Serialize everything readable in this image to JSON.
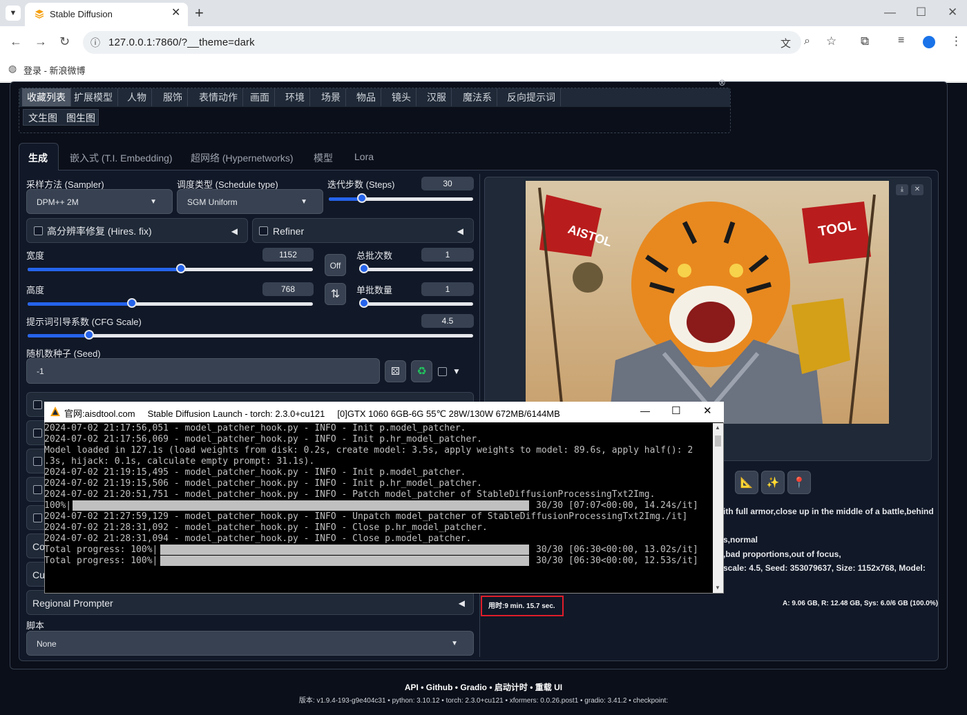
{
  "browser": {
    "tab_title": "Stable Diffusion",
    "url": "127.0.0.1:7860/?__theme=dark",
    "bookmark": "登录 - 新浪微博"
  },
  "top_tabs": [
    "收藏列表",
    "扩展模型",
    "人物",
    "服饰",
    "表情动作",
    "画面",
    "环境",
    "场景",
    "物品",
    "镜头",
    "汉服",
    "魔法系",
    "反向提示词"
  ],
  "sub_tabs": [
    "文生图",
    "图生图"
  ],
  "main_tabs": [
    "生成",
    "嵌入式 (T.I. Embedding)",
    "超网络 (Hypernetworks)",
    "模型",
    "Lora"
  ],
  "sampler": {
    "label": "采样方法 (Sampler)",
    "value": "DPM++ 2M"
  },
  "schedule": {
    "label": "调度类型 (Schedule type)",
    "value": "SGM Uniform"
  },
  "steps": {
    "label": "迭代步数 (Steps)",
    "value": "30",
    "fraction": 0.21
  },
  "hires": {
    "label": "高分辨率修复 (Hires. fix)"
  },
  "refiner": {
    "label": "Refiner"
  },
  "width": {
    "label": "宽度",
    "value": "1152",
    "fraction": 0.54
  },
  "height": {
    "label": "高度",
    "value": "768",
    "fraction": 0.36
  },
  "batch_count": {
    "label": "总批次数",
    "value": "1",
    "fraction": 0.0
  },
  "batch_size": {
    "label": "单批数量",
    "value": "1",
    "fraction": 0.0
  },
  "off_button": "Off",
  "swap_icon": "⇅",
  "cfg": {
    "label": "提示词引导系数 (CFG Scale)",
    "value": "4.5",
    "fraction": 0.13
  },
  "seed": {
    "label": "随机数种子 (Seed)",
    "value": "-1"
  },
  "partial_accordions": [
    "Co",
    "Cut"
  ],
  "regional": "Regional Prompter",
  "script": {
    "label": "脚本",
    "value": "None"
  },
  "console": {
    "title": "官网:aisdtool.com     Stable Diffusion Launch - torch: 2.3.0+cu121     [0]GTX 1060 6GB-6G 55℃ 28W/130W 672MB/6144MB",
    "lines": [
      "2024-07-02 21:17:56,051 - model_patcher_hook.py - INFO - Init p.model_patcher.",
      "2024-07-02 21:17:56,069 - model_patcher_hook.py - INFO - Init p.hr_model_patcher.",
      "Model loaded in 127.1s (load weights from disk: 0.2s, create model: 3.5s, apply weights to model: 89.6s, apply half(): 2",
      ".3s, hijack: 0.1s, calculate empty prompt: 31.1s).",
      "2024-07-02 21:19:15,495 - model_patcher_hook.py - INFO - Init p.model_patcher.",
      "2024-07-02 21:19:15,506 - model_patcher_hook.py - INFO - Init p.hr_model_patcher.",
      "2024-07-02 21:20:51,751 - model_patcher_hook.py - INFO - Patch model_patcher of StableDiffusionProcessingTxt2Img.",
      "100%|",
      "2024-07-02 21:27:59,129 - model_patcher_hook.py - INFO - Unpatch model_patcher of StableDiffusionProcessingTxt2Img./it]",
      "2024-07-02 21:28:31,092 - model_patcher_hook.py - INFO - Close p.hr_model_patcher.",
      "2024-07-02 21:28:31,094 - model_patcher_hook.py - INFO - Close p.model_patcher.",
      "Total progress: 100%|",
      "Total progress: 100%|"
    ],
    "progress_1": "30/30 [07:07<00:00, 14.24s/it]",
    "progress_2": "30/30 [06:30<00:00, 13.02s/it]",
    "progress_3": "30/30 [06:30<00:00, 12.53s/it]"
  },
  "image_flags": {
    "left": "AISTOL",
    "right": "TOOL"
  },
  "info": {
    "line1": "ith full armor,close up in the middle of a battle,behind",
    "line2": "s,normal",
    "line3": ",bad proportions,out of focus,",
    "line4": "scale: 4.5, Seed: 353079637, Size: 1152x768, Model:"
  },
  "time": "用时:9 min. 15.7 sec.",
  "vram": "A: 9.06 GB, R: 12.48 GB, Sys: 6.0/6 GB (100.0%)",
  "footer": {
    "links": [
      "API",
      "Github",
      "Gradio",
      "启动计时",
      "重载 UI"
    ],
    "versions": "版本: v1.9.4-193-g9e404c31  •  python: 3.10.12  •  torch: 2.3.0+cu121  •  xformers: 0.0.26.post1  •  gradio: 3.41.2  •  checkpoint:"
  }
}
